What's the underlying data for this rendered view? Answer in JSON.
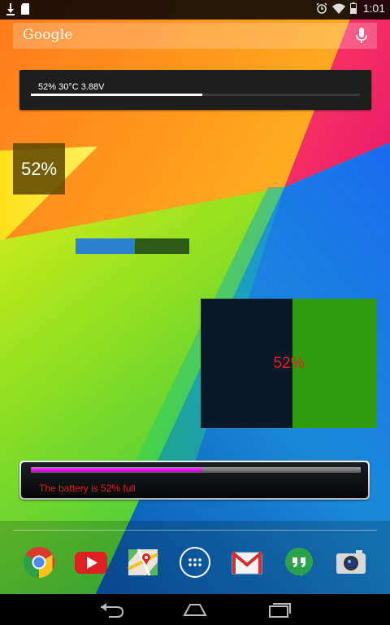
{
  "status_bar": {
    "time": "1:01",
    "icons": [
      "download-notification-icon",
      "sd-card-notification-icon",
      "alarm-icon",
      "wifi-icon",
      "battery-icon"
    ]
  },
  "search": {
    "logo": "Google",
    "icon": "mic-icon"
  },
  "widgets": {
    "w1": {
      "text": "52% 30°C 3.88V",
      "level": 0.52
    },
    "w2": {
      "text": "52%"
    },
    "w3": {
      "level": 0.52
    },
    "w4": {
      "text": "52%",
      "level": 0.52
    },
    "w5": {
      "text": "The battery is 52% full",
      "level": 0.52
    }
  },
  "dock": {
    "apps": [
      "Chrome",
      "YouTube",
      "Maps",
      "Apps",
      "Gmail",
      "Hangouts",
      "Camera"
    ]
  },
  "nav": {
    "buttons": [
      "back",
      "home",
      "recents"
    ]
  },
  "colors": {
    "w2_bg": "#5a4600",
    "w3_fill": "#2a7fd0",
    "w3_track": "#2d5a14",
    "w4_dark": "#0a1a2a",
    "w4_green": "#2f9c10",
    "w4_text": "#e82020",
    "w5_fill": "#e000e8",
    "w5_text": "#e02020"
  }
}
